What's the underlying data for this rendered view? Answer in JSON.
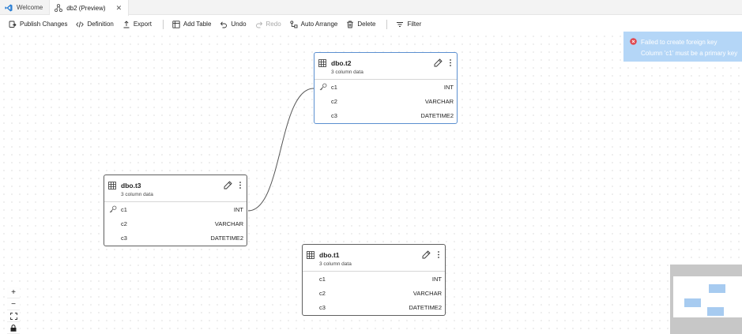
{
  "tabs": [
    {
      "label": "Welcome",
      "icon": "vscode-logo-icon",
      "active": false
    },
    {
      "label": "db2 (Preview)",
      "icon": "schema-designer-icon",
      "active": true
    }
  ],
  "toolbar": {
    "publish_label": "Publish Changes",
    "definition_label": "Definition",
    "export_label": "Export",
    "add_table_label": "Add Table",
    "undo_label": "Undo",
    "redo_label": "Redo",
    "auto_arrange_label": "Auto Arrange",
    "delete_label": "Delete",
    "filter_label": "Filter"
  },
  "tables": [
    {
      "title": "dbo.t2",
      "subtitle": "3 column data",
      "columns": [
        {
          "name": "c1",
          "type": "INT",
          "key": true
        },
        {
          "name": "c2",
          "type": "VARCHAR",
          "key": false
        },
        {
          "name": "c3",
          "type": "DATETIME2",
          "key": false
        }
      ]
    },
    {
      "title": "dbo.t3",
      "subtitle": "3 column data",
      "columns": [
        {
          "name": "c1",
          "type": "INT",
          "key": true
        },
        {
          "name": "c2",
          "type": "VARCHAR",
          "key": false
        },
        {
          "name": "c3",
          "type": "DATETIME2",
          "key": false
        }
      ]
    },
    {
      "title": "dbo.t1",
      "subtitle": "3 column data",
      "columns": [
        {
          "name": "c1",
          "type": "INT",
          "key": false
        },
        {
          "name": "c2",
          "type": "VARCHAR",
          "key": false
        },
        {
          "name": "c3",
          "type": "DATETIME2",
          "key": false
        }
      ]
    }
  ],
  "controls": {
    "zoom_in": "+",
    "zoom_out": "−",
    "fit_view": "fit-view-icon",
    "lock": "lock-icon"
  },
  "toast": {
    "title": "Failed to create foreign key",
    "message": "Column 'c1' must be a primary key"
  },
  "colors": {
    "selected_border": "#5b8fd0",
    "toast_background": "#b4d6f7",
    "error_icon": "#e0484f",
    "minimap_node": "#a7cbf0"
  }
}
